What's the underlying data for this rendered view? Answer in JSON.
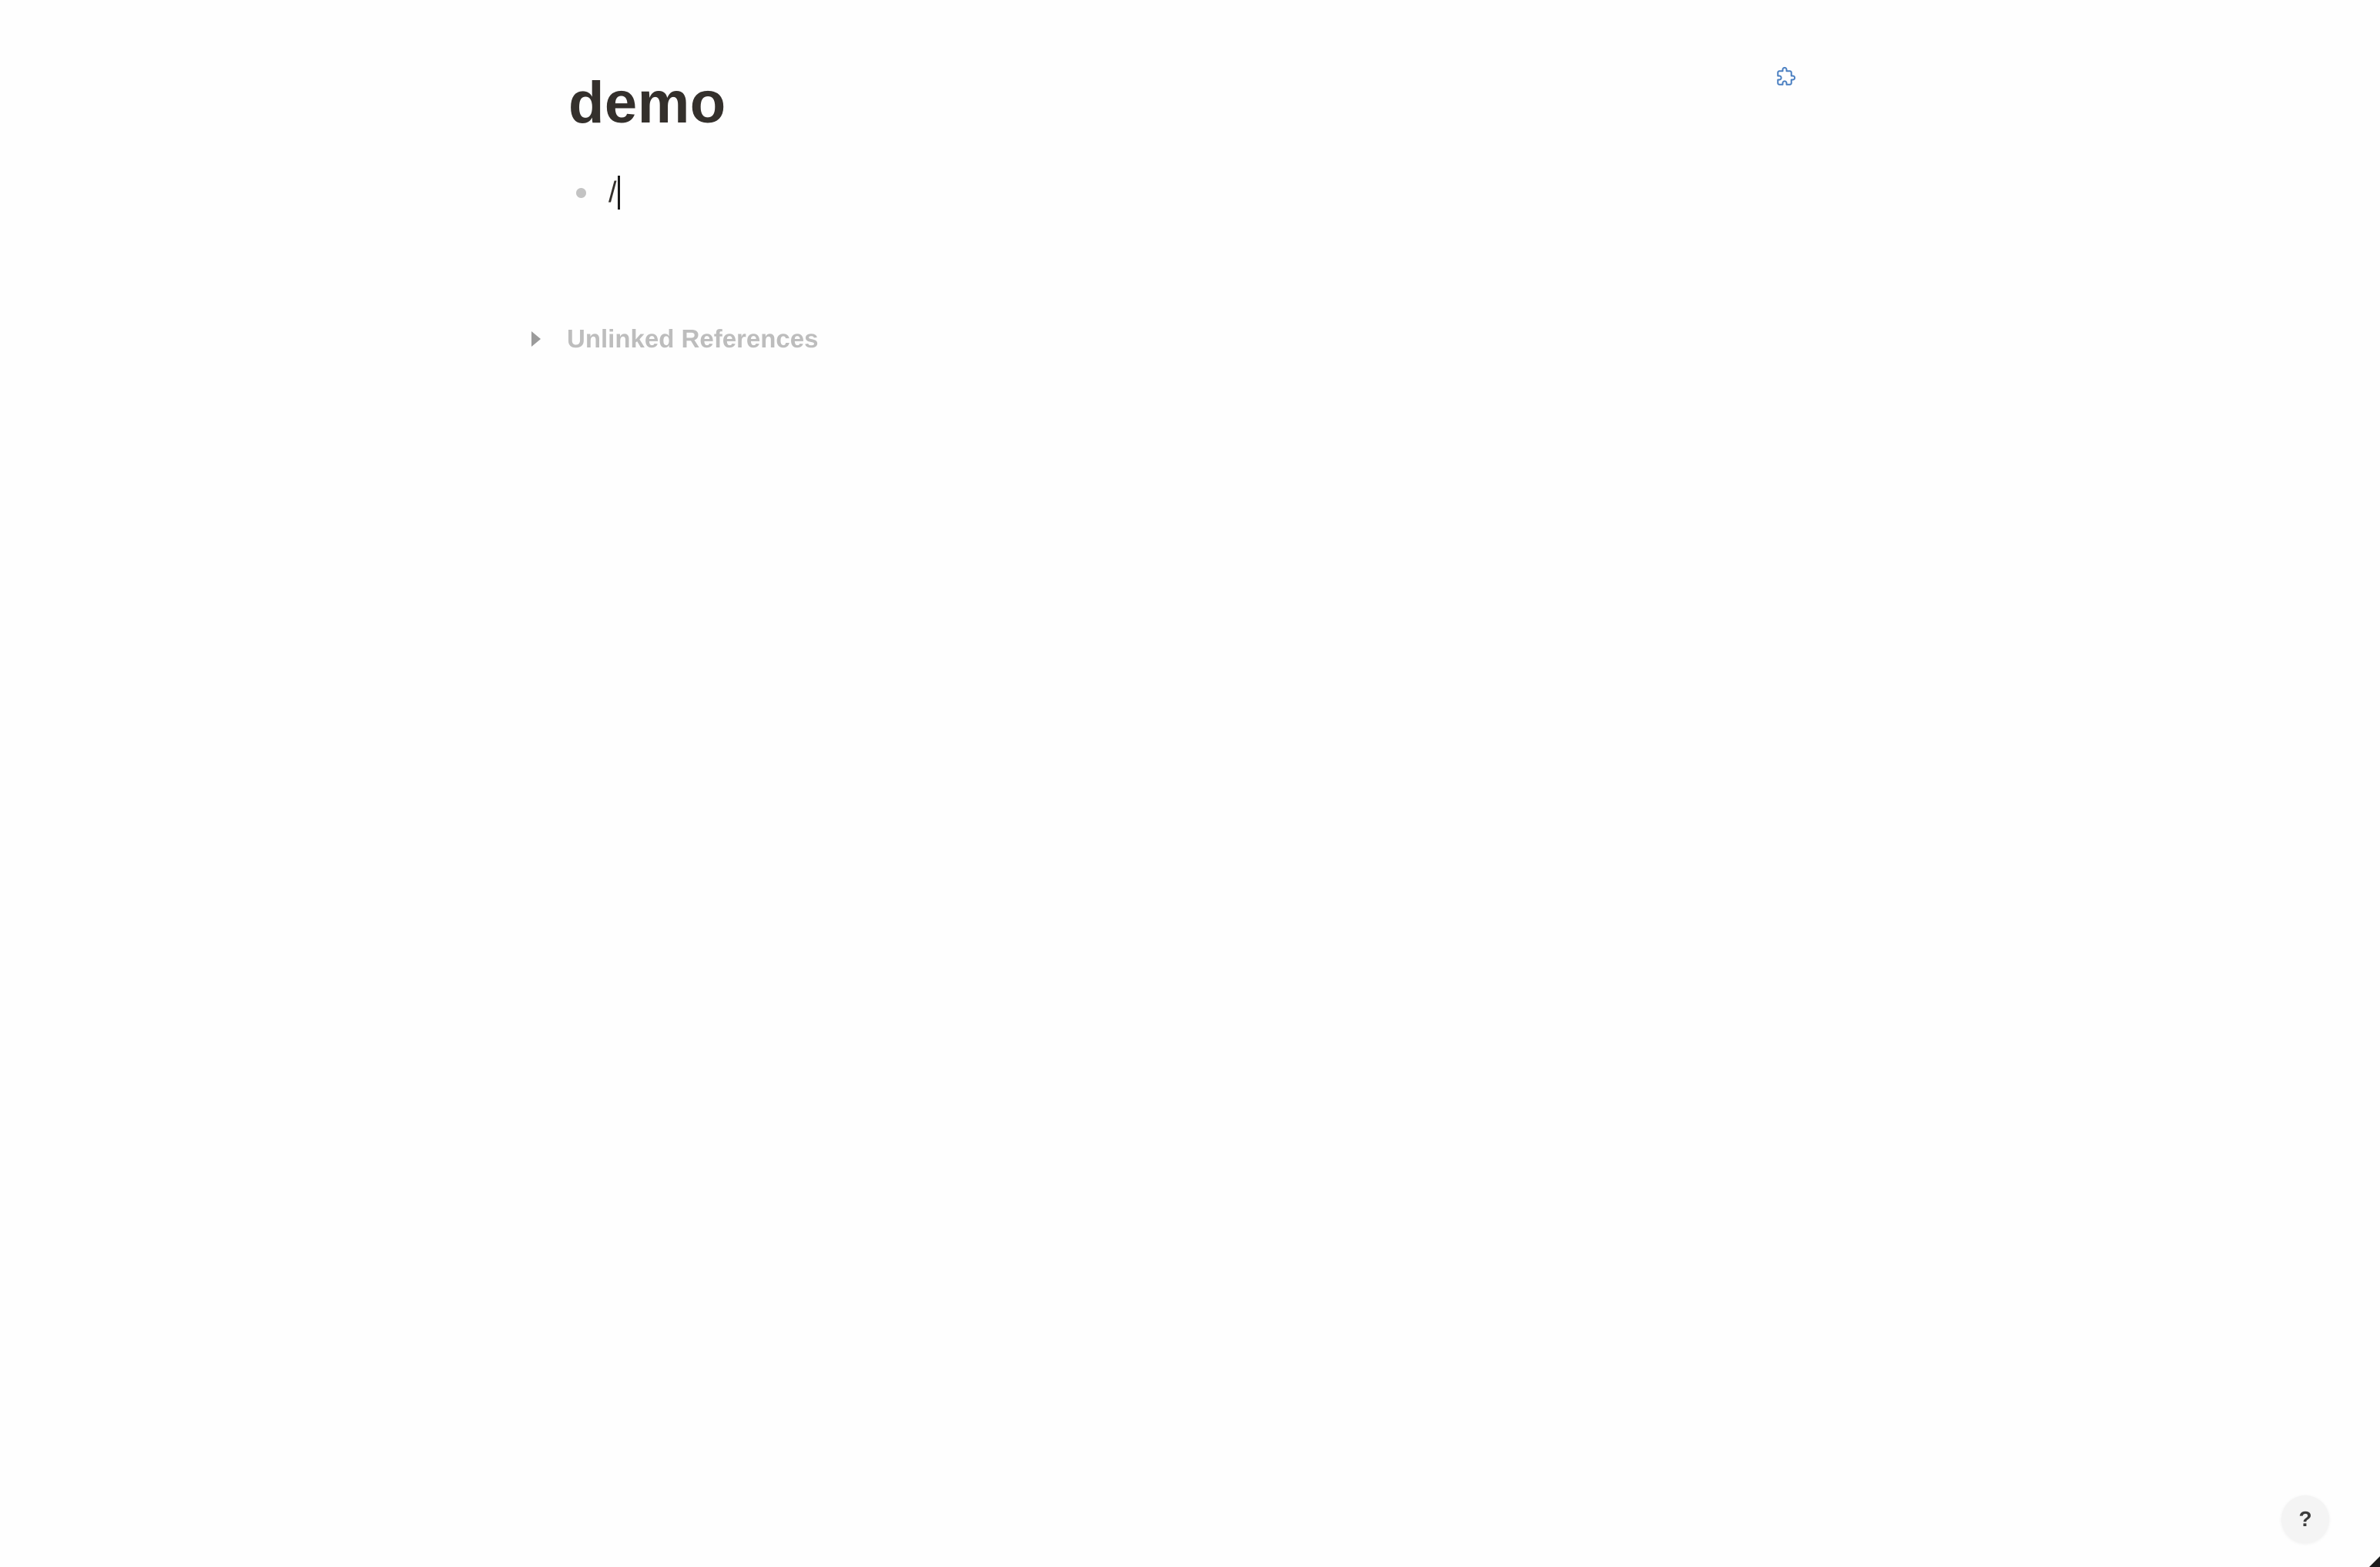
{
  "page": {
    "title": "demo"
  },
  "block": {
    "content": "/"
  },
  "references": {
    "unlinked_label": "Unlinked References"
  },
  "toolbar": {
    "plugin_icon": "puzzle-icon"
  },
  "help": {
    "label": "?"
  },
  "colors": {
    "title": "#34302c",
    "bullet": "#c3c3c3",
    "muted": "#bdbdbd",
    "icon_accent": "#4a7fc1"
  }
}
